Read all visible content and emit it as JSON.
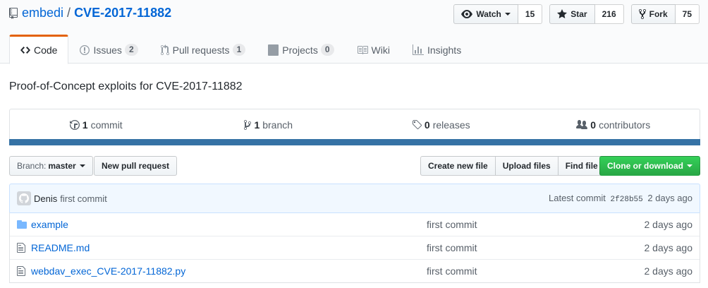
{
  "repo": {
    "owner": "embedi",
    "separator": "/",
    "name": "CVE-2017-11882"
  },
  "actions": {
    "watch": {
      "label": "Watch",
      "count": "15"
    },
    "star": {
      "label": "Star",
      "count": "216"
    },
    "fork": {
      "label": "Fork",
      "count": "75"
    }
  },
  "tabs": [
    {
      "label": "Code",
      "counter": ""
    },
    {
      "label": "Issues",
      "counter": "2"
    },
    {
      "label": "Pull requests",
      "counter": "1"
    },
    {
      "label": "Projects",
      "counter": "0"
    },
    {
      "label": "Wiki",
      "counter": ""
    },
    {
      "label": "Insights",
      "counter": ""
    }
  ],
  "description": "Proof-of-Concept exploits for CVE-2017-11882",
  "summary": {
    "commits": {
      "num": "1",
      "label": "commit"
    },
    "branches": {
      "num": "1",
      "label": "branch"
    },
    "releases": {
      "num": "0",
      "label": "releases"
    },
    "contributors": {
      "num": "0",
      "label": "contributors"
    },
    "language_color": "#3572a5"
  },
  "filenav": {
    "branch_prefix": "Branch:",
    "branch": "master",
    "new_pr": "New pull request",
    "create_file": "Create new file",
    "upload": "Upload files",
    "find": "Find file",
    "clone": "Clone or download"
  },
  "commit": {
    "author": "Denis",
    "message": "first commit",
    "latest_label": "Latest commit",
    "sha": "2f28b55",
    "age": "2 days ago"
  },
  "files": [
    {
      "type": "dir",
      "name": "example",
      "message": "first commit",
      "age": "2 days ago"
    },
    {
      "type": "file",
      "name": "README.md",
      "message": "first commit",
      "age": "2 days ago"
    },
    {
      "type": "file",
      "name": "webdav_exec_CVE-2017-11882.py",
      "message": "first commit",
      "age": "2 days ago"
    }
  ]
}
